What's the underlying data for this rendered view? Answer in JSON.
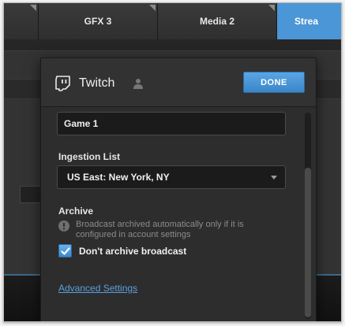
{
  "tabs": [
    {
      "label": ""
    },
    {
      "label": "GFX 3"
    },
    {
      "label": "Media 2"
    },
    {
      "label": "Strea"
    }
  ],
  "popover": {
    "title": "Twitch",
    "done_label": "DONE",
    "title_field_value": "Game 1",
    "ingestion_label": "Ingestion List",
    "ingestion_selected": "US East: New York, NY",
    "archive_label": "Archive",
    "archive_info": "Broadcast archived automatically only if it is configured in account settings",
    "dont_archive_label": "Don't archive broadcast",
    "dont_archive_checked": true,
    "advanced_link": "Advanced Settings"
  },
  "colors": {
    "accent": "#4a96d6",
    "link": "#5aa0dc",
    "background": "#262626"
  },
  "icons": [
    "twitch-icon",
    "user-icon",
    "chevron-down-icon",
    "info-icon",
    "checkmark-icon"
  ]
}
